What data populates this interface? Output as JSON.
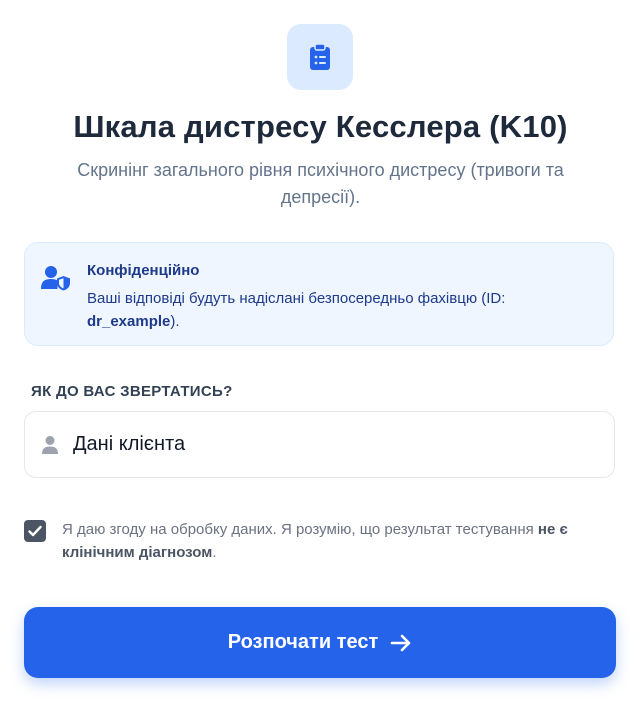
{
  "header": {
    "icon": "clipboard-list-icon",
    "title": "Шкала дистресу Кесслера (K10)",
    "subtitle": "Скринінг загального рівня психічного дистресу (тривоги та депресії)."
  },
  "notice": {
    "icon": "user-shield-icon",
    "title": "Конфіденційно",
    "text_before": "Ваші відповіді будуть надіслані безпосередньо фахівцю (ID: ",
    "specialist_id": "dr_example",
    "text_after": ")."
  },
  "client_field": {
    "label": "ЯК ДО ВАС ЗВЕРТАТИСЬ?",
    "icon": "user-icon",
    "value": "Дані клієнта"
  },
  "consent": {
    "checked": true,
    "text_before": "Я даю згоду на обробку даних. Я розумію, що результат тестування ",
    "text_bold": "не є клінічним діагнозом",
    "text_after": "."
  },
  "start_button": {
    "label": "Розпочати тест",
    "icon": "arrow-right-icon"
  },
  "colors": {
    "primary": "#2563eb",
    "icon_bg": "#dbeafe",
    "notice_bg": "#eff6ff",
    "notice_text": "#1e3a8a",
    "checkbox": "#4b5563"
  }
}
